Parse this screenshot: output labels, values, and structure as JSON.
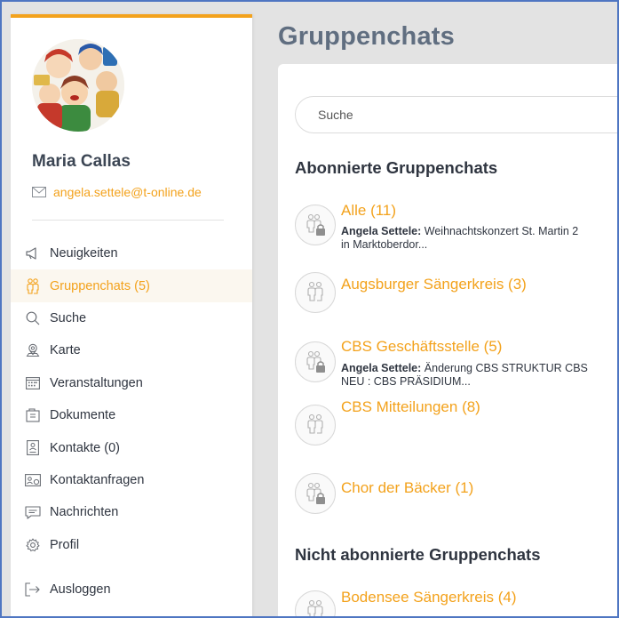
{
  "page_title": "Gruppenchats",
  "profile": {
    "name": "Maria Callas",
    "email": "angela.settele@t-online.de"
  },
  "menu": [
    {
      "label": "Neuigkeiten",
      "icon": "megaphone-icon",
      "active": false
    },
    {
      "label": "Gruppenchats (5)",
      "icon": "group-icon",
      "active": true
    },
    {
      "label": "Suche",
      "icon": "search-icon",
      "active": false
    },
    {
      "label": "Karte",
      "icon": "map-pin-icon",
      "active": false
    },
    {
      "label": "Veranstaltungen",
      "icon": "calendar-icon",
      "active": false
    },
    {
      "label": "Dokumente",
      "icon": "documents-icon",
      "active": false
    },
    {
      "label": "Kontakte (0)",
      "icon": "contact-card-icon",
      "active": false
    },
    {
      "label": "Kontaktanfragen",
      "icon": "contact-request-icon",
      "active": false
    },
    {
      "label": "Nachrichten",
      "icon": "chat-bubble-icon",
      "active": false
    },
    {
      "label": "Profil",
      "icon": "gear-icon",
      "active": false
    },
    {
      "label": "Ausloggen",
      "icon": "logout-icon",
      "active": false
    }
  ],
  "search": {
    "placeholder": "Suche"
  },
  "subscribed_title": "Abonnierte Gruppenchats",
  "subscribed": [
    {
      "name": "Alle (11)",
      "locked": true,
      "sender": "Angela Settele:",
      "message": " Weihnachtskonzert St. Martin 2",
      "message2": "in Marktoberdor..."
    },
    {
      "name": "Augsburger Sängerkreis (3)",
      "locked": false,
      "sender": "",
      "message": "",
      "message2": ""
    },
    {
      "name": "CBS Geschäftsstelle (5)",
      "locked": true,
      "sender": "Angela Settele:",
      "message": " Änderung CBS STRUKTUR CBS",
      "message2": "NEU : CBS PRÄSIDIUM..."
    },
    {
      "name": "CBS Mitteilungen (8)",
      "locked": false,
      "sender": "",
      "message": "",
      "message2": ""
    },
    {
      "name": "Chor der Bäcker (1)",
      "locked": true,
      "sender": "",
      "message": "",
      "message2": ""
    }
  ],
  "unsubscribed_title": "Nicht abonnierte Gruppenchats",
  "unsubscribed": [
    {
      "name": "Bodensee Sängerkreis (4)",
      "locked": false
    }
  ],
  "colors": {
    "accent": "#f3a21c",
    "title": "#606e80",
    "text": "#2f3540"
  }
}
